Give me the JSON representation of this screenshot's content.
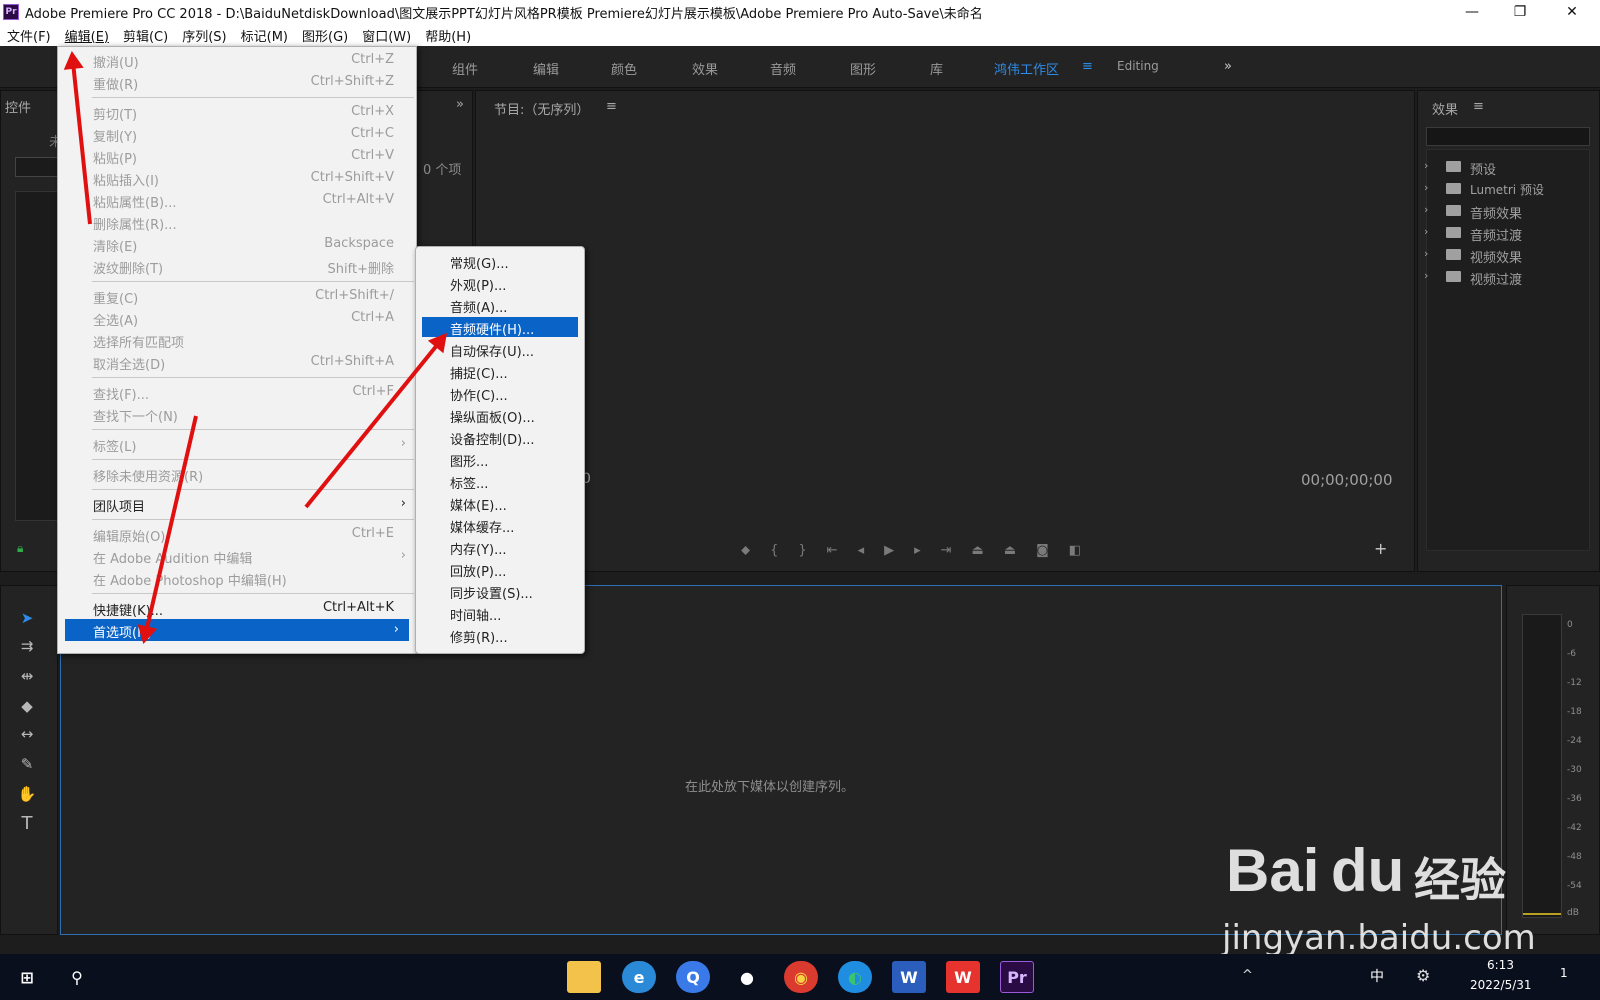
{
  "window": {
    "app_icon": "Pr",
    "title": "Adobe Premiere Pro CC 2018 - D:\\BaiduNetdiskDownload\\图文展示PPT幻灯片风格PR模板 Premiere幻灯片展示模板\\Adobe Premiere Pro Auto-Save\\未命名",
    "minimize": "—",
    "maximize": "❐",
    "close": "✕"
  },
  "menubar": [
    "文件(F)",
    "编辑(E)",
    "剪辑(C)",
    "序列(S)",
    "标记(M)",
    "图形(G)",
    "窗口(W)",
    "帮助(H)"
  ],
  "workspaces": {
    "items": [
      "组件",
      "编辑",
      "颜色",
      "效果",
      "音频",
      "图形",
      "库"
    ],
    "active": "鸿伟工作区",
    "editing": "Editing",
    "more": "»"
  },
  "left_panel": {
    "title": "控件",
    "title2": "未",
    "items_count": "0 个项"
  },
  "program_monitor": {
    "title": "节目:（无序列）",
    "timecode_left": "0",
    "timecode_right": "00;00;00;00"
  },
  "effects_panel": {
    "title": "效果",
    "items": [
      "预设",
      "Lumetri 预设",
      "音频效果",
      "音频过渡",
      "视频效果",
      "视频过渡"
    ]
  },
  "timeline": {
    "placeholder": "在此处放下媒体以创建序列。"
  },
  "meter": {
    "labels": [
      "0",
      "-6",
      "-12",
      "-18",
      "-24",
      "-30",
      "-36",
      "-42",
      "-48",
      "-54",
      "dB"
    ]
  },
  "edit_menu": {
    "items": [
      {
        "label": "撤消(U)",
        "shortcut": "Ctrl+Z",
        "disabled": true
      },
      {
        "label": "重做(R)",
        "shortcut": "Ctrl+Shift+Z",
        "disabled": true
      },
      {
        "label": "剪切(T)",
        "shortcut": "Ctrl+X",
        "disabled": true
      },
      {
        "label": "复制(Y)",
        "shortcut": "Ctrl+C",
        "disabled": true
      },
      {
        "label": "粘贴(P)",
        "shortcut": "Ctrl+V",
        "disabled": true
      },
      {
        "label": "粘贴插入(I)",
        "shortcut": "Ctrl+Shift+V",
        "disabled": true
      },
      {
        "label": "粘贴属性(B)...",
        "shortcut": "Ctrl+Alt+V",
        "disabled": true
      },
      {
        "label": "删除属性(R)...",
        "shortcut": "",
        "disabled": true
      },
      {
        "label": "清除(E)",
        "shortcut": "Backspace",
        "disabled": true
      },
      {
        "label": "波纹删除(T)",
        "shortcut": "Shift+删除",
        "disabled": true
      },
      {
        "label": "重复(C)",
        "shortcut": "Ctrl+Shift+/",
        "disabled": true
      },
      {
        "label": "全选(A)",
        "shortcut": "Ctrl+A",
        "disabled": true
      },
      {
        "label": "选择所有匹配项",
        "shortcut": "",
        "disabled": true
      },
      {
        "label": "取消全选(D)",
        "shortcut": "Ctrl+Shift+A",
        "disabled": true
      },
      {
        "label": "查找(F)...",
        "shortcut": "Ctrl+F",
        "disabled": true
      },
      {
        "label": "查找下一个(N)",
        "shortcut": "",
        "disabled": true
      },
      {
        "label": "标签(L)",
        "shortcut": "",
        "disabled": true
      },
      {
        "label": "移除未使用资源(R)",
        "shortcut": "",
        "disabled": true
      },
      {
        "label": "团队项目",
        "shortcut": "",
        "disabled": false
      },
      {
        "label": "编辑原始(O)",
        "shortcut": "Ctrl+E",
        "disabled": true
      },
      {
        "label": "在 Adobe Audition 中编辑",
        "shortcut": "",
        "disabled": true
      },
      {
        "label": "在 Adobe Photoshop 中编辑(H)",
        "shortcut": "",
        "disabled": true
      },
      {
        "label": "快捷键(K)...",
        "shortcut": "Ctrl+Alt+K",
        "disabled": false
      },
      {
        "label": "首选项(N)",
        "shortcut": "",
        "disabled": false
      }
    ]
  },
  "preferences_submenu": {
    "items": [
      "常规(G)...",
      "外观(P)...",
      "音频(A)...",
      "音频硬件(H)...",
      "自动保存(U)...",
      "捕捉(C)...",
      "协作(C)...",
      "操纵面板(O)...",
      "设备控制(D)...",
      "图形...",
      "标签...",
      "媒体(E)...",
      "媒体缓存...",
      "内存(Y)...",
      "回放(P)...",
      "同步设置(S)...",
      "时间轴...",
      "修剪(R)..."
    ],
    "selected": "音频硬件(H)..."
  },
  "watermark": {
    "brand": "Bai",
    "brand2": "du",
    "cn": "经验",
    "url": "jingyan.baidu.com"
  },
  "taskbar": {
    "time": "6:13",
    "date": "2022/5/31",
    "ime": "中",
    "notification_count": "1"
  }
}
